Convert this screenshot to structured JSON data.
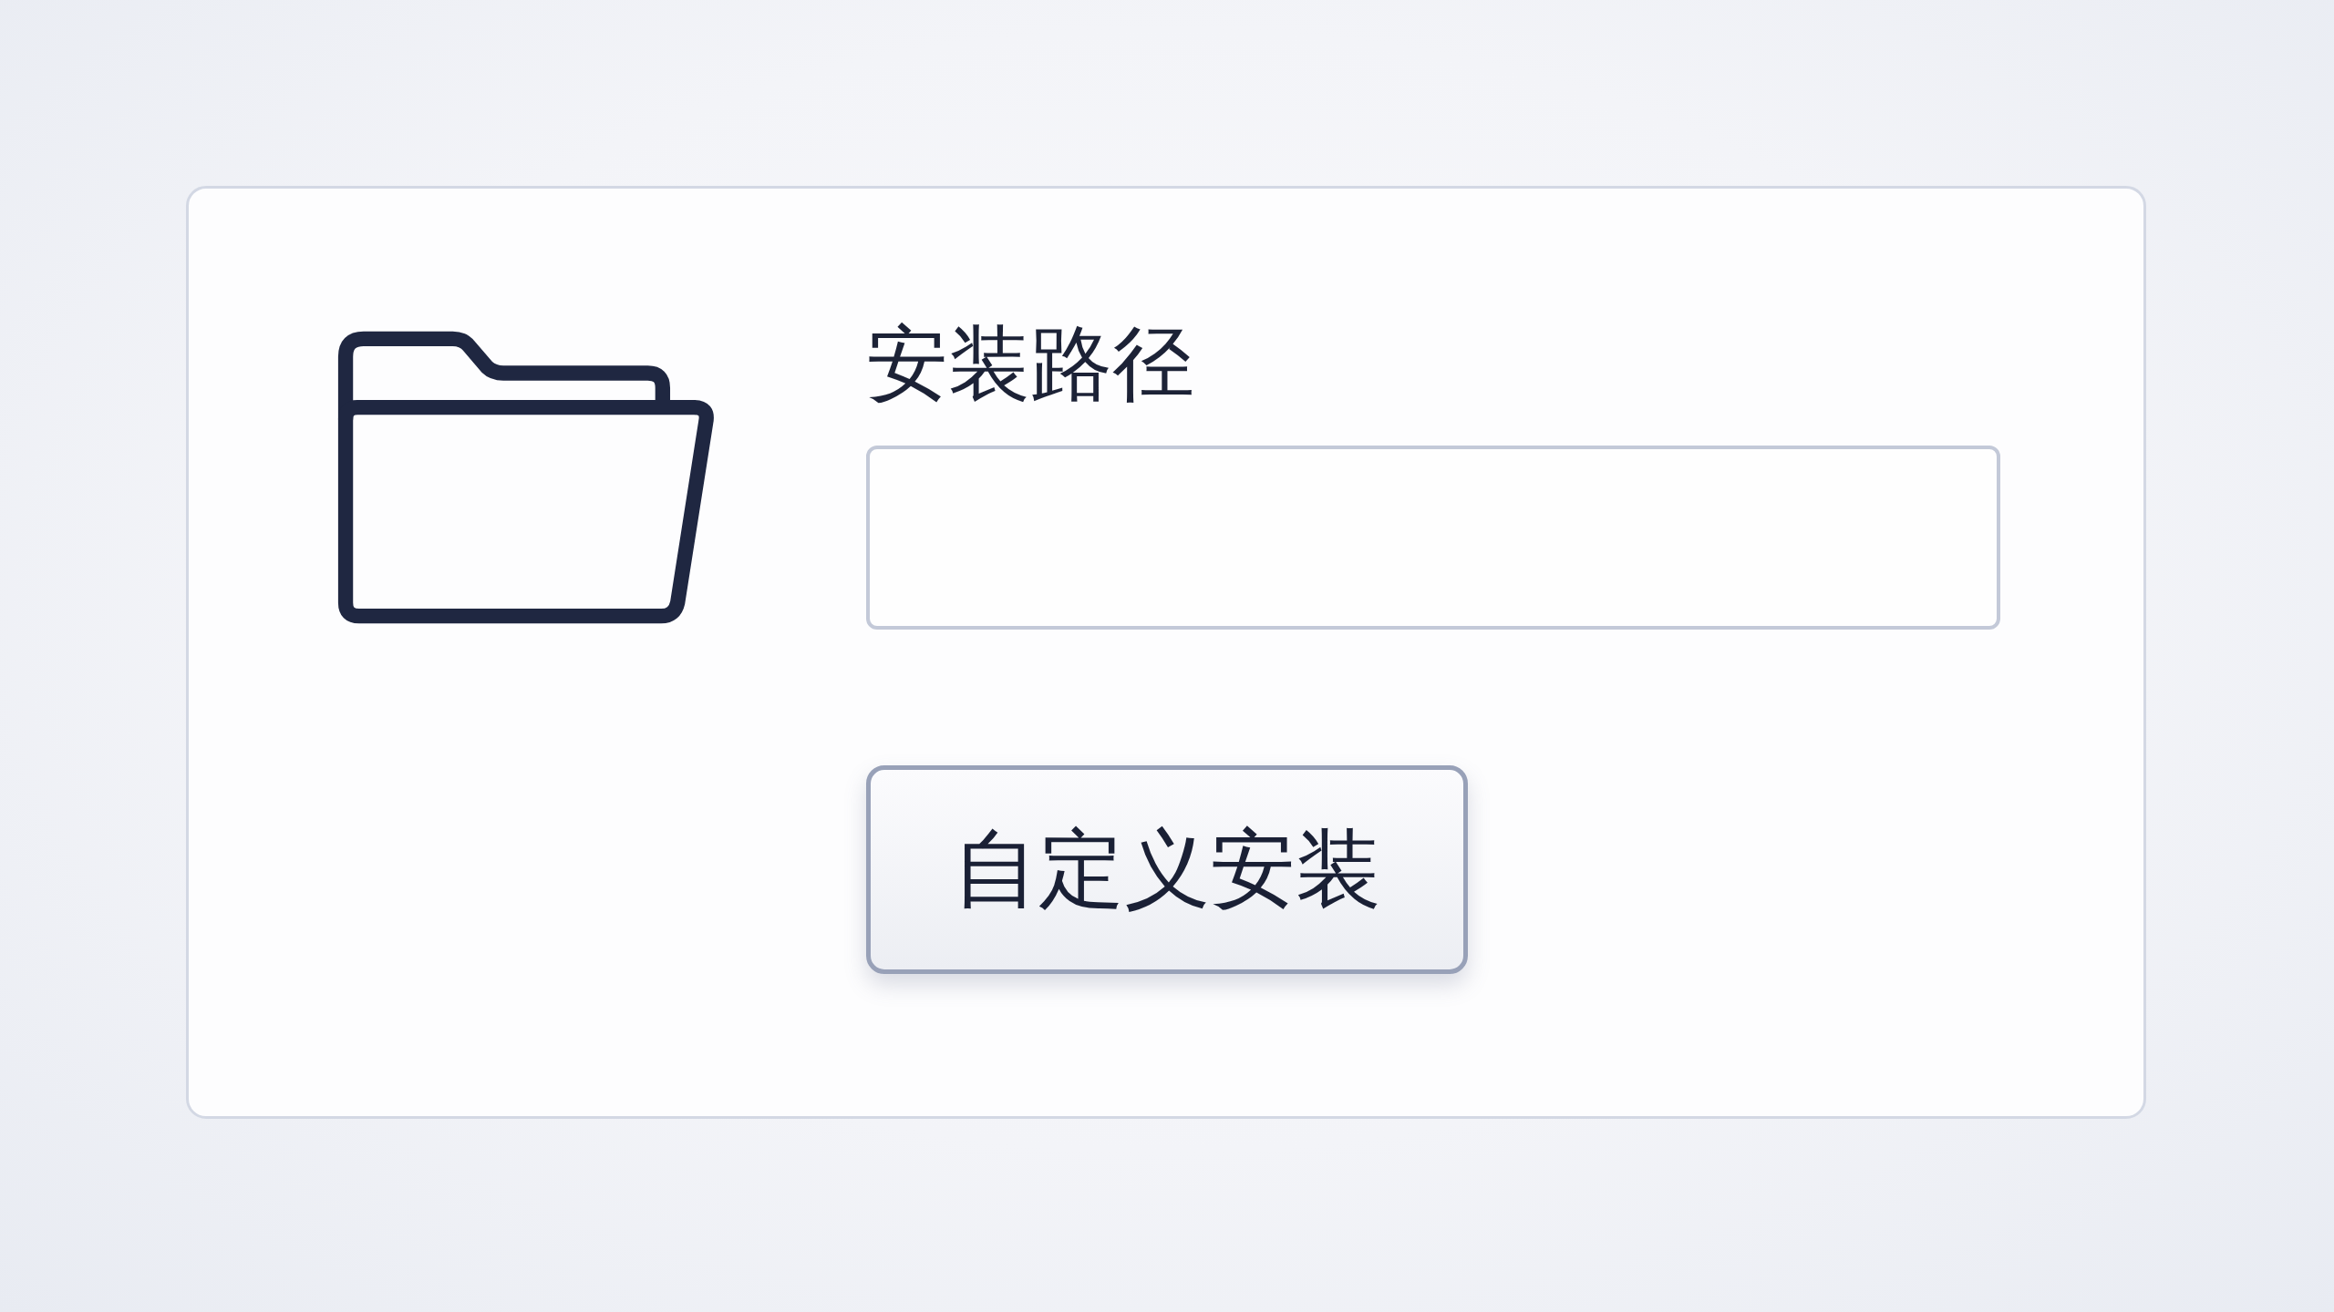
{
  "path_label": "安装路径",
  "button": {
    "label": "自定义安装"
  }
}
